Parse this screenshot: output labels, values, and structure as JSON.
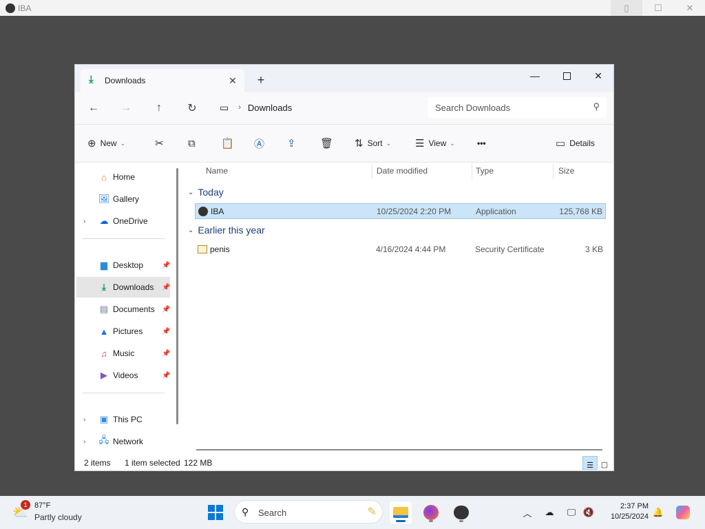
{
  "host": {
    "title": "IBA",
    "controls": [
      "minimize",
      "maximize",
      "close"
    ]
  },
  "explorer": {
    "tab": {
      "label": "Downloads"
    },
    "window_controls": [
      "minimize",
      "maximize",
      "close"
    ],
    "address": {
      "crumb": "Downloads"
    },
    "search": {
      "placeholder": "Search Downloads"
    },
    "commands": {
      "new": "New",
      "sort": "Sort",
      "view": "View",
      "more": "•••",
      "details": "Details"
    },
    "sidebar": {
      "items": [
        {
          "label": "Home",
          "icon": "home-icon"
        },
        {
          "label": "Gallery",
          "icon": "gallery-icon"
        },
        {
          "label": "OneDrive",
          "icon": "cloud-icon"
        },
        {
          "label": "Desktop",
          "icon": "desktop-icon"
        },
        {
          "label": "Downloads",
          "icon": "download-icon"
        },
        {
          "label": "Documents",
          "icon": "document-icon"
        },
        {
          "label": "Pictures",
          "icon": "picture-icon"
        },
        {
          "label": "Music",
          "icon": "music-icon"
        },
        {
          "label": "Videos",
          "icon": "video-icon"
        },
        {
          "label": "This PC",
          "icon": "pc-icon"
        },
        {
          "label": "Network",
          "icon": "network-icon"
        }
      ]
    },
    "columns": [
      "Name",
      "Date modified",
      "Type",
      "Size"
    ],
    "groups": [
      {
        "label": "Today",
        "files": [
          {
            "name": "IBA",
            "date": "10/25/2024 2:20 PM",
            "type": "Application",
            "size": "125,768 KB",
            "selected": true
          }
        ]
      },
      {
        "label": "Earlier this year",
        "files": [
          {
            "name": "penis",
            "date": "4/16/2024 4:44 PM",
            "type": "Security Certificate",
            "size": "3 KB",
            "selected": false
          }
        ]
      }
    ],
    "status": {
      "count": "2 items",
      "selection": "1 item selected",
      "size": "122 MB"
    }
  },
  "taskbar": {
    "weather": {
      "temp": "87°F",
      "condition": "Partly cloudy",
      "badge": "1"
    },
    "search": {
      "placeholder": "Search"
    },
    "clock": {
      "time": "2:37 PM",
      "date": "10/25/2024"
    }
  },
  "colors": {
    "selection": "#cce4f7",
    "accent": "#0067c0",
    "group_header": "#1a3e78"
  }
}
